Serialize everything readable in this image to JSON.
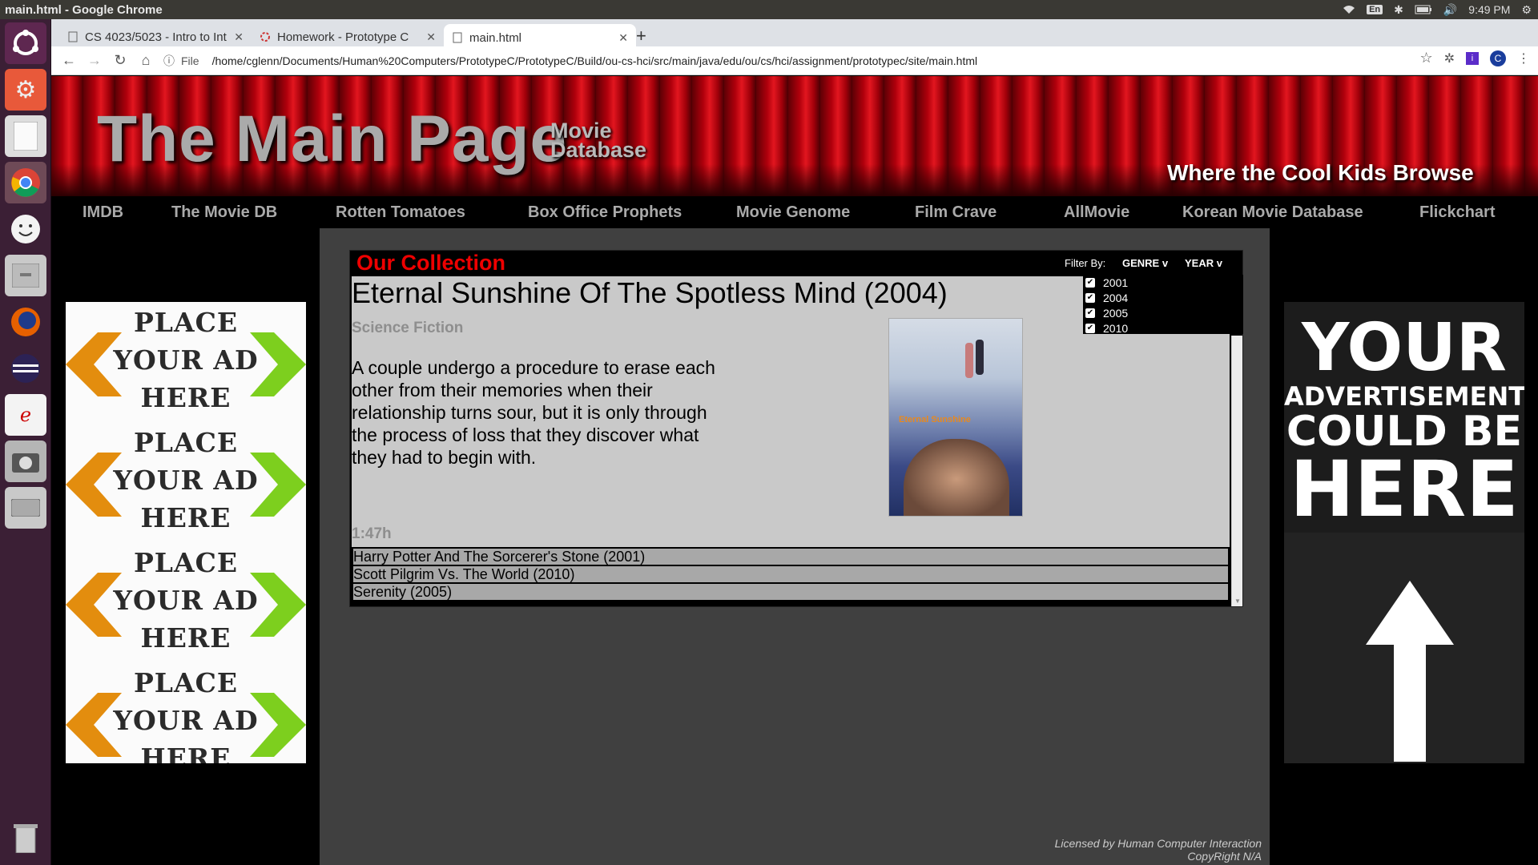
{
  "os": {
    "window_title": "main.html - Google Chrome",
    "lang": "En",
    "clock": "9:49 PM"
  },
  "browser": {
    "tabs": [
      {
        "label": "CS 4023/5023 - Intro to Int"
      },
      {
        "label": "Homework - Prototype C"
      },
      {
        "label": "main.html"
      }
    ],
    "omnibox": {
      "scheme_label": "File",
      "url": "/home/cglenn/Documents/Human%20Computers/PrototypeC/PrototypeC/Build/ou-cs-hci/src/main/java/edu/ou/cs/hci/assignment/prototypec/site/main.html"
    },
    "profile_initial": "C"
  },
  "site": {
    "title": "The Main Page",
    "subtitle_line1": "Movie",
    "subtitle_line2": "Database",
    "tagline": "Where the Cool Kids Browse",
    "nav": [
      "IMDB",
      "The Movie DB",
      "Rotten Tomatoes",
      "Box Office Prophets",
      "Movie Genome",
      "Film Crave",
      "AllMovie",
      "Korean Movie Database",
      "Flickchart"
    ]
  },
  "collection": {
    "heading": "Our Collection",
    "filter_label": "Filter By:",
    "genre_button": "GENRE v",
    "year_button": "YEAR v",
    "years": [
      {
        "label": "2001",
        "checked": true
      },
      {
        "label": "2004",
        "checked": true
      },
      {
        "label": "2005",
        "checked": true
      },
      {
        "label": "2010",
        "checked": true
      }
    ],
    "selected_movie": {
      "title": "Eternal Sunshine Of The Spotless Mind (2004)",
      "genre": "Science Fiction",
      "description": "A couple undergo a procedure to erase each other from their memories when their relationship turns sour, but it is only through the process of loss that they discover what they had to begin with.",
      "runtime": "1:47h",
      "poster_text": "Eternal Sunshine"
    },
    "movies": [
      "Harry Potter And The Sorcerer's Stone (2001)",
      "Scott Pilgrim Vs. The World (2010)",
      "Serenity (2005)"
    ]
  },
  "ads": {
    "left_lines": [
      "PLACE",
      "YOUR AD",
      "HERE"
    ],
    "right_lines": [
      "YOUR",
      "ADVERTISEMENT",
      "COULD BE",
      "HERE"
    ]
  },
  "footer": {
    "line1": "Licensed by Human Computer Interaction",
    "line2": "CopyRight N/A"
  },
  "colors": {
    "accent_red": "#ee0000",
    "launcher_bg": "#3b1f35",
    "content_bg": "#404040"
  }
}
